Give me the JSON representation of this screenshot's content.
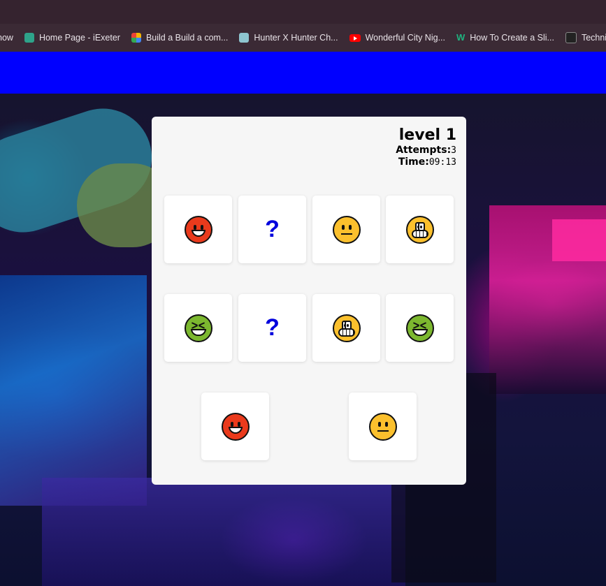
{
  "bookmarks": [
    {
      "label": "now",
      "icon": "none"
    },
    {
      "label": "Home Page - iExeter",
      "icon": "iexeter-icon"
    },
    {
      "label": "Build a Build a com...",
      "icon": "build-icon"
    },
    {
      "label": "Hunter X Hunter Ch...",
      "icon": "hxh-icon"
    },
    {
      "label": "Wonderful City Nig...",
      "icon": "youtube-icon"
    },
    {
      "label": "How To Create a Sli...",
      "icon": "w-icon"
    },
    {
      "label": "Technical Ac",
      "icon": "ta-icon"
    }
  ],
  "game": {
    "level": "level 1",
    "attempts_label": "Attempts:",
    "attempts_value": "3",
    "time_label": "Time:",
    "time_value": "09:13",
    "hidden_symbol": "?"
  },
  "tiles": [
    {
      "state": "revealed",
      "face": "angry"
    },
    {
      "state": "hidden"
    },
    {
      "state": "revealed",
      "face": "neutral"
    },
    {
      "state": "revealed",
      "face": "grin"
    },
    {
      "state": "revealed",
      "face": "squint"
    },
    {
      "state": "hidden"
    },
    {
      "state": "revealed",
      "face": "grin"
    },
    {
      "state": "revealed",
      "face": "squint"
    },
    {
      "state": "revealed",
      "face": "angry"
    },
    {
      "state": "revealed",
      "face": "neutral"
    }
  ],
  "colors": {
    "header_bar": "#0000ff",
    "card_bg": "#f6f6f6",
    "hidden_symbol": "#0000dd"
  }
}
